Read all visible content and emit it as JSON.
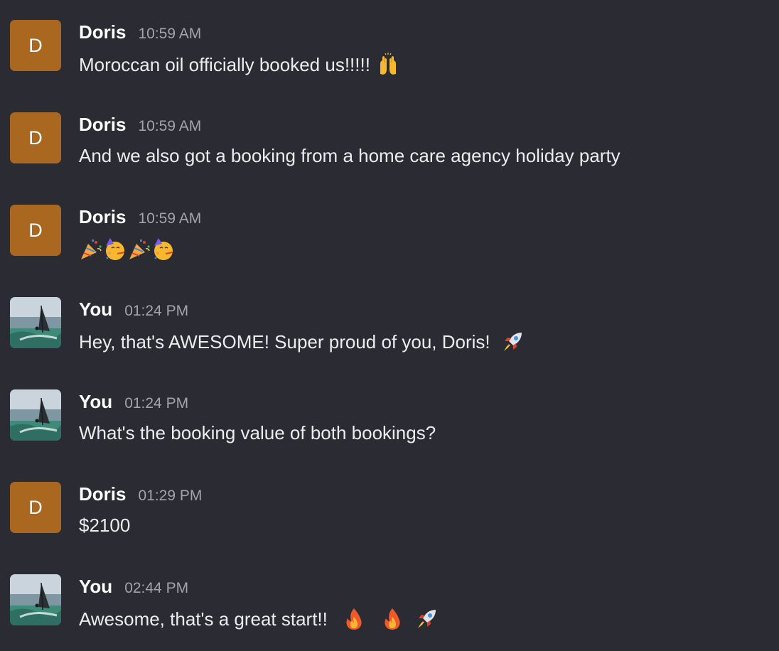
{
  "messages": [
    {
      "author": "Doris",
      "avatar_letter": "D",
      "time": "10:59 AM",
      "text": "Moroccan oil officially booked us!!!!!",
      "emoji": [
        "raising-hands"
      ]
    },
    {
      "author": "Doris",
      "avatar_letter": "D",
      "time": "10:59 AM",
      "text": "And we also got a booking from a home care agency holiday party",
      "emoji": []
    },
    {
      "author": "Doris",
      "avatar_letter": "D",
      "time": "10:59 AM",
      "text": "",
      "emoji": [
        "party-popper",
        "partying-face",
        "party-popper",
        "partying-face"
      ]
    },
    {
      "author": "You",
      "avatar": "windsurf-photo",
      "time": "01:24 PM",
      "text": "Hey, that's AWESOME! Super proud of you, Doris!",
      "emoji": [
        "rocket"
      ]
    },
    {
      "author": "You",
      "avatar": "windsurf-photo",
      "time": "01:24 PM",
      "text": "What's the booking value of both bookings?",
      "emoji": []
    },
    {
      "author": "Doris",
      "avatar_letter": "D",
      "time": "01:29 PM",
      "text": "$2100",
      "emoji": []
    },
    {
      "author": "You",
      "avatar": "windsurf-photo",
      "time": "02:44 PM",
      "text": "Awesome, that's a great start!!",
      "emoji": [
        "fire",
        "fire",
        "rocket"
      ]
    }
  ],
  "colors": {
    "background": "#2b2c33",
    "avatar_doris": "#a9671f",
    "author_text": "#ffffff",
    "timestamp_text": "#a3a4aa",
    "message_text": "#ececee"
  }
}
